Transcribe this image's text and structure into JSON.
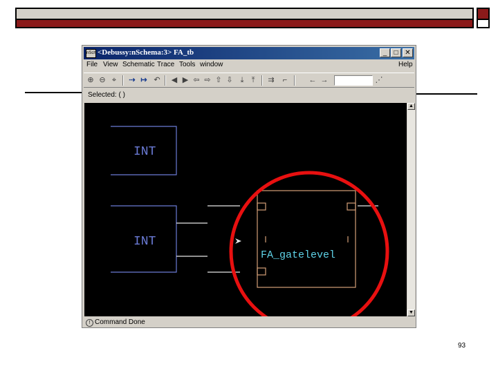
{
  "window": {
    "title": "<Debussy:nSchema:3> FA_tb",
    "app_icon": "nSch"
  },
  "menu": [
    "File",
    "View",
    "Schematic",
    "Trace",
    "Tools",
    "window",
    "Help"
  ],
  "selection_label": "Selected: ( )",
  "schematic": {
    "block1_label": "INT",
    "block2_label": "INT",
    "module_label": "FA_gatelevel"
  },
  "status": "Command Done",
  "page_number": "93",
  "colors": {
    "titlebar": "#0a246a",
    "banner_red": "#8b1a1a",
    "wire": "#e8e8e8",
    "block": "#6b7bd6",
    "module": "#d4a078",
    "module_text": "#5fd3e8",
    "highlight_circle": "#e81010"
  }
}
